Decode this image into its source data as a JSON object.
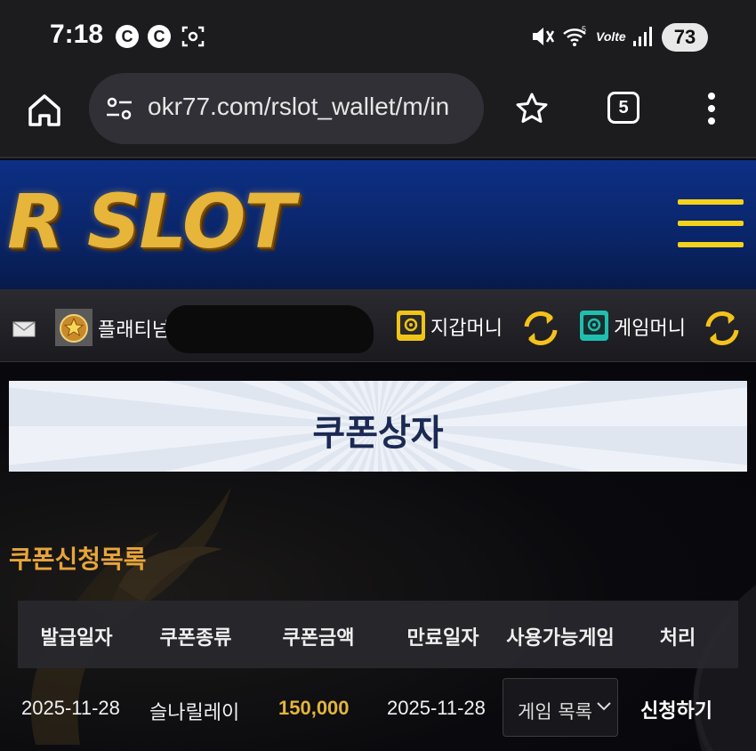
{
  "statusbar": {
    "time": "7:18",
    "icon1": "C",
    "icon2": "C",
    "battery": "73"
  },
  "browser": {
    "url": "okr77.com/rslot_wallet/m/in",
    "tab_count": "5"
  },
  "site": {
    "logo_text": "R SLOT"
  },
  "userbar": {
    "grade": "플래티넘",
    "wallet_money_label": "지갑머니",
    "game_money_label": "게임머니"
  },
  "page": {
    "title": "쿠폰상자",
    "section_title": "쿠폰신청목록"
  },
  "table": {
    "headers": [
      "발급일자",
      "쿠폰종류",
      "쿠폰금액",
      "만료일자",
      "사용가능게임",
      "처리"
    ],
    "rows": [
      {
        "issue_date": "2025-11-28",
        "coupon_type": "슬나릴레이",
        "amount": "150,000",
        "expire_date": "2025-11-28",
        "game_select": "게임 목록",
        "action": "신청하기"
      }
    ]
  },
  "colors": {
    "header_blue": "#0d2f85",
    "hamburger_yellow": "#f4d21b",
    "section_orange": "#e8a53a",
    "amount_gold": "#e2b53c",
    "wallet_yellow": "#f0c419",
    "game_teal": "#1fbfb0"
  }
}
